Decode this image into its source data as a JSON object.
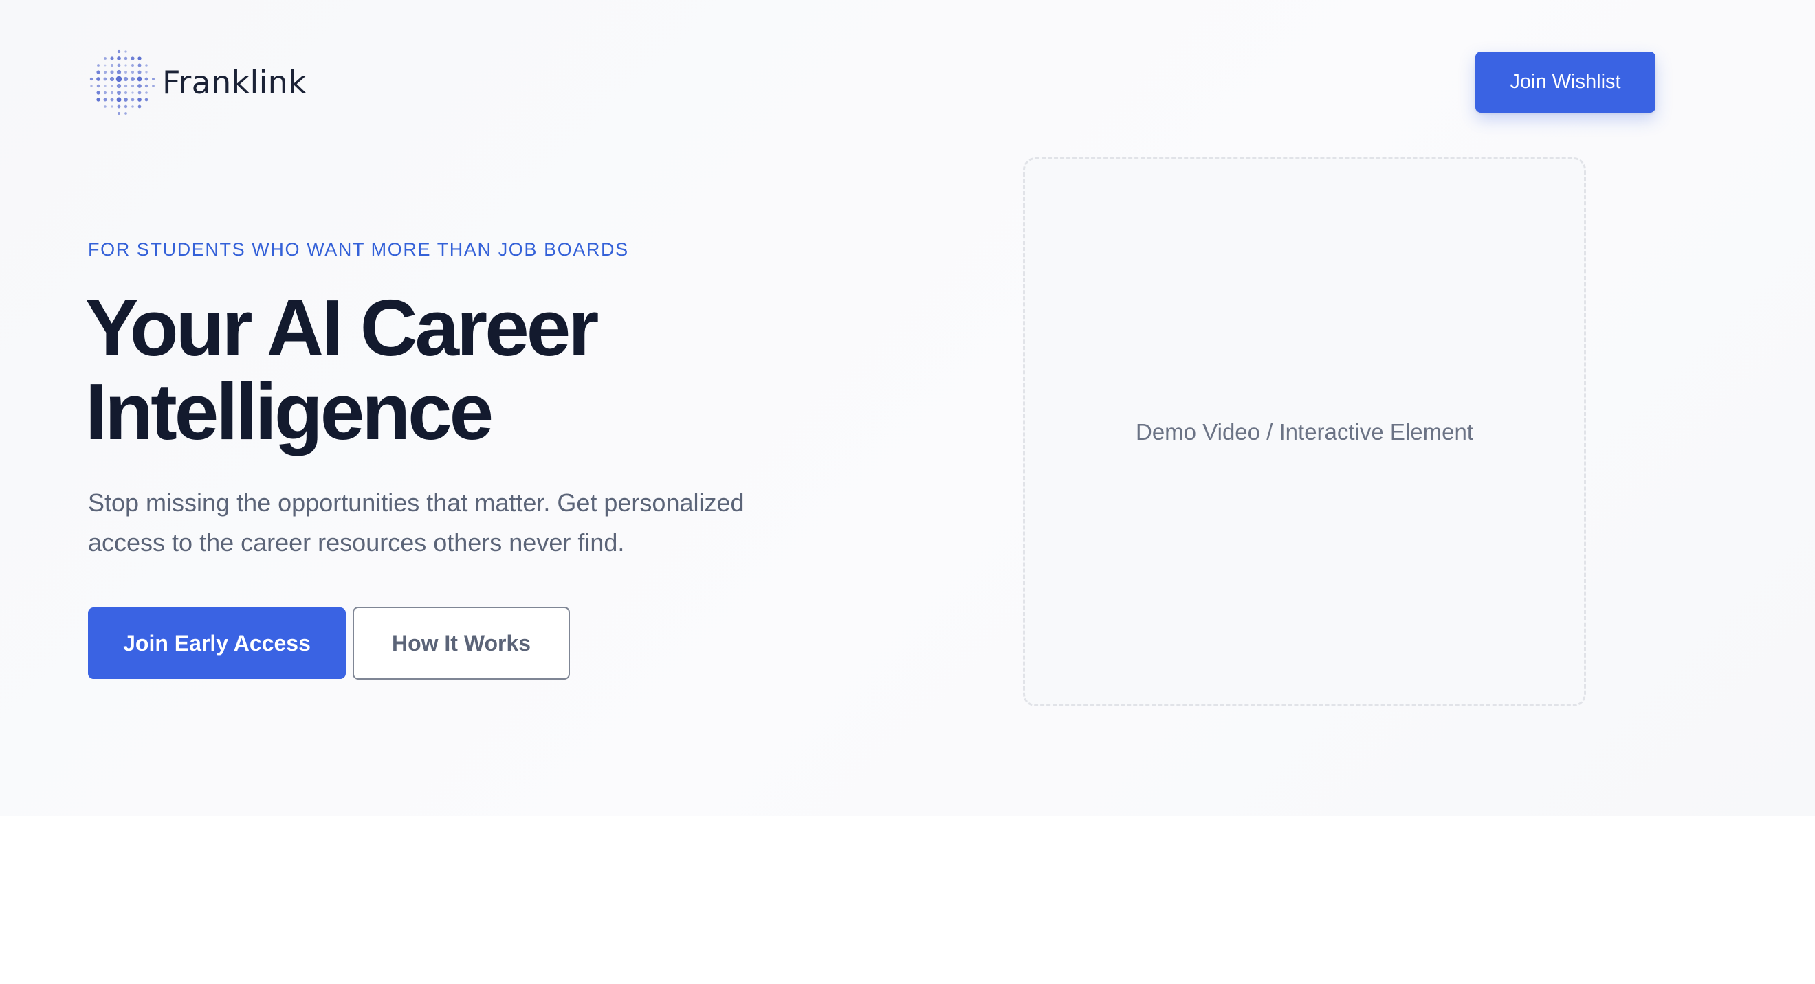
{
  "brand": {
    "name": "Franklink",
    "logo_icon": "dotted-sphere-icon"
  },
  "nav": {
    "wishlist_label": "Join Wishlist"
  },
  "hero": {
    "eyebrow": "FOR STUDENTS WHO WANT MORE THAN JOB BOARDS",
    "headline_line1": "Your AI Career",
    "headline_line2": "Intelligence",
    "subheadline": "Stop missing the opportunities that matter. Get personalized access to the career resources others never find.",
    "primary_cta": "Join Early Access",
    "secondary_cta": "How It Works"
  },
  "demo": {
    "placeholder": "Demo Video / Interactive Element"
  },
  "colors": {
    "accent": "#3a63e3",
    "eyebrow": "#3461d8",
    "heading": "#131a2e",
    "body_text": "#5b6478",
    "logo_dots": "#5b6fd0"
  }
}
